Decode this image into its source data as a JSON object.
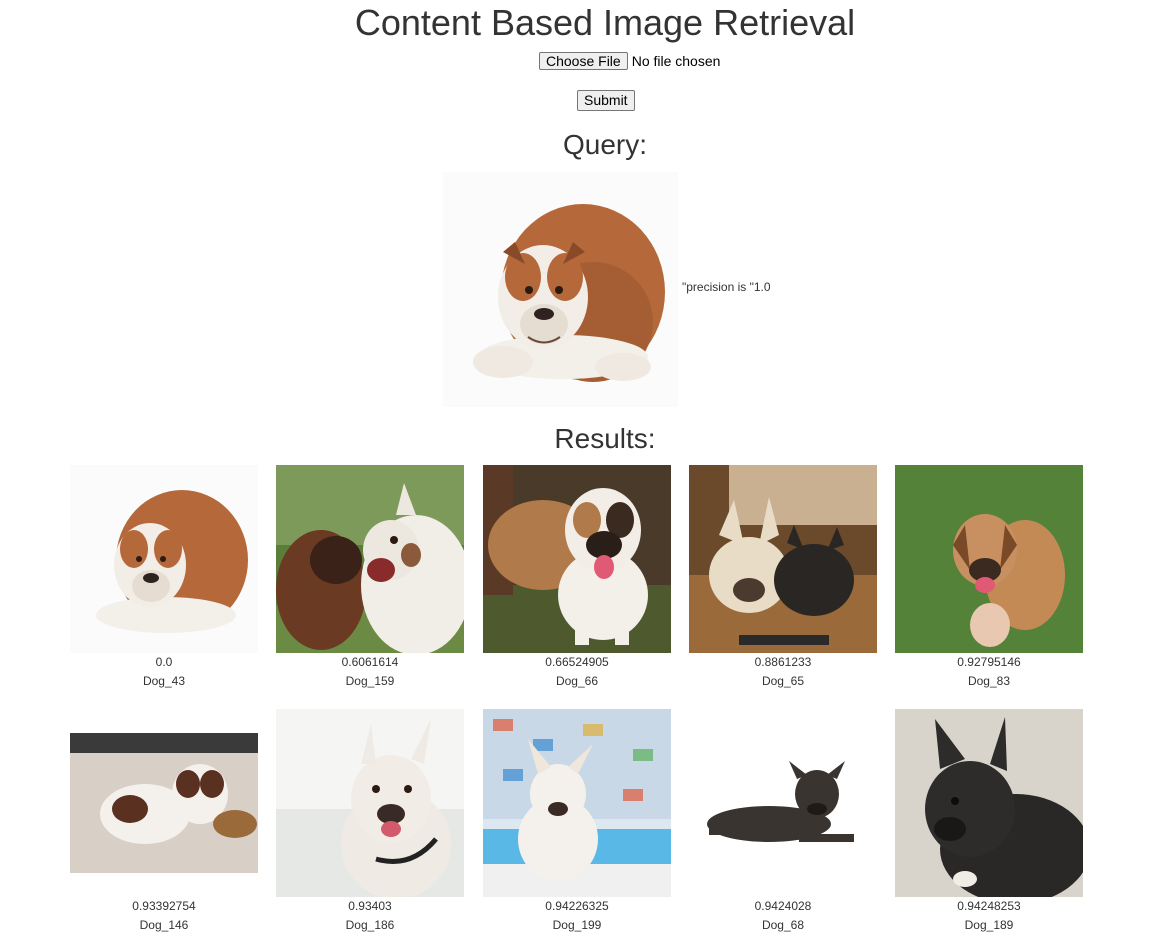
{
  "page": {
    "title": "Content Based Image Retrieval"
  },
  "upload": {
    "choose_label": "Choose File",
    "status": "No file chosen",
    "submit_label": "Submit"
  },
  "query": {
    "heading": "Query:",
    "image_icon": "bulldog-photo",
    "precision_text": "\"precision is \"1.0"
  },
  "results": {
    "heading": "Results:",
    "items": [
      {
        "score": "0.0",
        "label": "Dog_43"
      },
      {
        "score": "0.6061614",
        "label": "Dog_159"
      },
      {
        "score": "0.66524905",
        "label": "Dog_66"
      },
      {
        "score": "0.8861233",
        "label": "Dog_65"
      },
      {
        "score": "0.92795146",
        "label": "Dog_83"
      },
      {
        "score": "0.93392754",
        "label": "Dog_146"
      },
      {
        "score": "0.93403",
        "label": "Dog_186"
      },
      {
        "score": "0.94226325",
        "label": "Dog_199"
      },
      {
        "score": "0.9424028",
        "label": "Dog_68"
      },
      {
        "score": "0.94248253",
        "label": "Dog_189"
      }
    ]
  },
  "colors": {
    "text": "#333333",
    "button_bg": "#efefef",
    "button_border": "#767676"
  }
}
